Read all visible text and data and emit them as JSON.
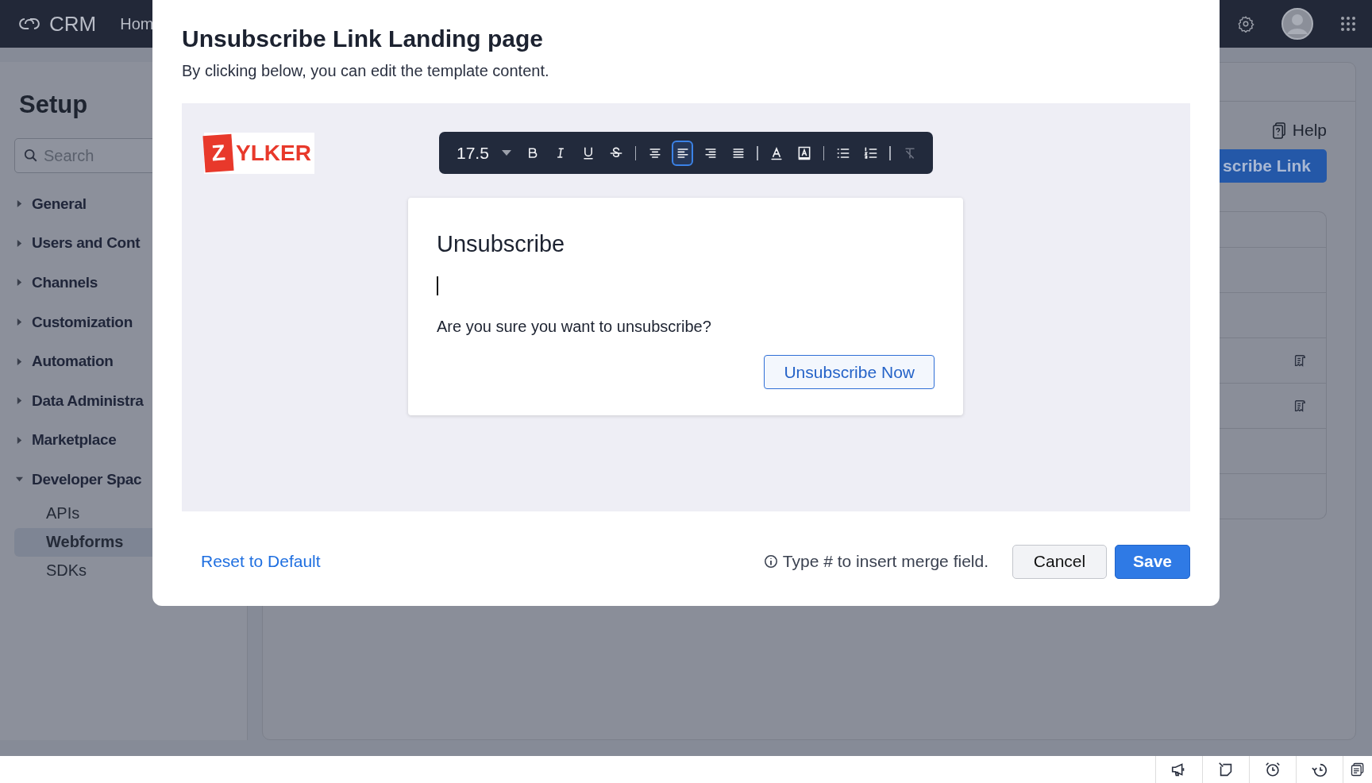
{
  "topbar": {
    "brand": "CRM",
    "nav_item": "Hom"
  },
  "sidebar": {
    "title": "Setup",
    "search": {
      "placeholder": "Search"
    },
    "items": [
      {
        "label": "General",
        "expanded": false
      },
      {
        "label": "Users and Cont",
        "expanded": false
      },
      {
        "label": "Channels",
        "expanded": false
      },
      {
        "label": "Customization",
        "expanded": false
      },
      {
        "label": "Automation",
        "expanded": false
      },
      {
        "label": "Data Administra",
        "expanded": false
      },
      {
        "label": "Marketplace",
        "expanded": false
      },
      {
        "label": "Developer Spac",
        "expanded": true,
        "children": [
          {
            "label": "APIs",
            "selected": false
          },
          {
            "label": "Webforms",
            "selected": true
          },
          {
            "label": "SDKs",
            "selected": false
          }
        ]
      }
    ]
  },
  "page": {
    "help": "Help",
    "primary_button": "scribe Link"
  },
  "modal": {
    "title": "Unsubscribe Link Landing page",
    "subtitle": "By clicking below, you can edit the template content.",
    "logo": {
      "mark": "Z",
      "text": "YLKER"
    },
    "toolbar": {
      "font_size": "17.5",
      "tools": [
        {
          "kind": "bold",
          "selected": false,
          "disabled": false
        },
        {
          "kind": "italic",
          "selected": false,
          "disabled": false
        },
        {
          "kind": "underline",
          "selected": false,
          "disabled": false
        },
        {
          "kind": "strike",
          "selected": false,
          "disabled": false
        },
        {
          "kind": "sep"
        },
        {
          "kind": "align-center",
          "selected": false,
          "disabled": false
        },
        {
          "kind": "align-left",
          "selected": true,
          "disabled": false
        },
        {
          "kind": "align-right",
          "selected": false,
          "disabled": false
        },
        {
          "kind": "justify",
          "selected": false,
          "disabled": false
        },
        {
          "kind": "sep"
        },
        {
          "kind": "text-color",
          "selected": false,
          "disabled": false
        },
        {
          "kind": "highlight",
          "selected": false,
          "disabled": false
        },
        {
          "kind": "sep"
        },
        {
          "kind": "bullets",
          "selected": false,
          "disabled": false
        },
        {
          "kind": "numbers",
          "selected": false,
          "disabled": false
        },
        {
          "kind": "sep"
        },
        {
          "kind": "clear-format",
          "selected": false,
          "disabled": true
        }
      ]
    },
    "card": {
      "heading": "Unsubscribe",
      "question": "Are you sure you want to unsubscribe?",
      "button": "Unsubscribe Now"
    },
    "reset": "Reset to Default",
    "hint": "Type # to insert merge field.",
    "cancel": "Cancel",
    "save": "Save"
  }
}
